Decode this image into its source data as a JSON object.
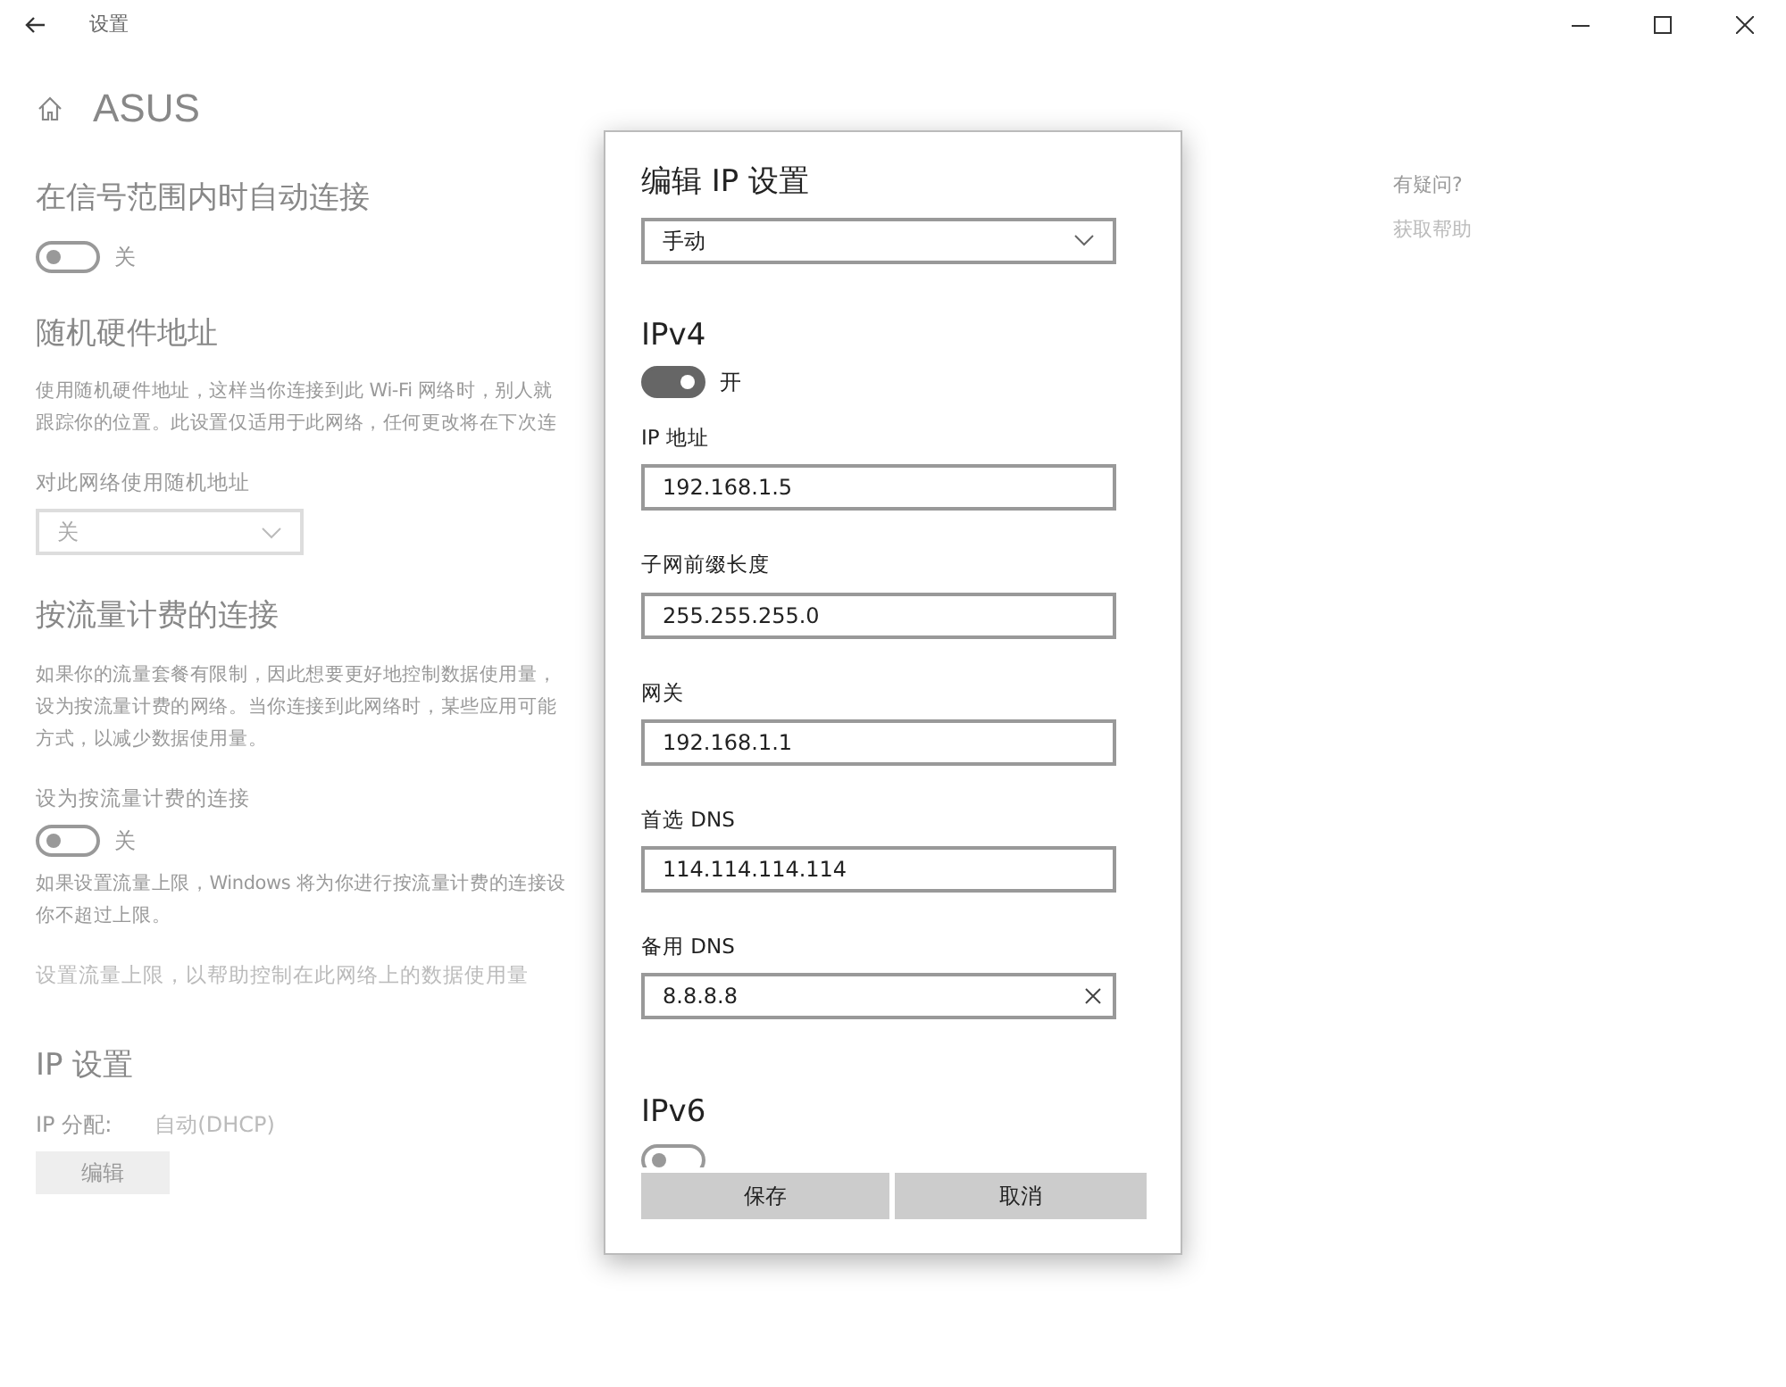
{
  "window": {
    "title": "设置"
  },
  "page": {
    "title": "ASUS",
    "content": [
      {
        "kind": "heading",
        "text": "在信号范围内时自动连接"
      },
      {
        "kind": "toggle",
        "on": false,
        "label": "关"
      },
      {
        "kind": "heading",
        "text": "随机硬件地址"
      },
      {
        "kind": "paragraph",
        "lines": [
          "使用随机硬件地址，这样当你连接到此 Wi-Fi 网络时，别人就",
          "跟踪你的位置。此设置仅适用于此网络，任何更改将在下次连"
        ]
      },
      {
        "kind": "label",
        "text": "对此网络使用随机地址"
      },
      {
        "kind": "dropdown",
        "value": "关"
      },
      {
        "kind": "heading",
        "text": "按流量计费的连接"
      },
      {
        "kind": "paragraph",
        "lines": [
          "如果你的流量套餐有限制，因此想要更好地控制数据使用量，",
          "设为按流量计费的网络。当你连接到此网络时，某些应用可能",
          "方式，以减少数据使用量。"
        ]
      },
      {
        "kind": "label",
        "text": "设为按流量计费的连接"
      },
      {
        "kind": "toggle",
        "on": false,
        "label": "关"
      },
      {
        "kind": "paragraph",
        "lines": [
          "如果设置流量上限，Windows 将为你进行按流量计费的连接设",
          "你不超过上限。"
        ]
      },
      {
        "kind": "link",
        "text": "设置流量上限，以帮助控制在此网络上的数据使用量"
      },
      {
        "kind": "heading",
        "text": "IP 设置"
      },
      {
        "kind": "pair",
        "label": "IP 分配:",
        "value": "自动(DHCP)"
      },
      {
        "kind": "button",
        "text": "编辑"
      }
    ]
  },
  "help": {
    "title": "有疑问?",
    "link": "获取帮助"
  },
  "dialog": {
    "title": "编辑 IP 设置",
    "mode": "手动",
    "ipv4": {
      "heading": "IPv4",
      "on": true,
      "state_label": "开",
      "fields": [
        {
          "label": "IP 地址",
          "value": "192.168.1.5",
          "clearable": false
        },
        {
          "label": "子网前缀长度",
          "value": "255.255.255.0",
          "clearable": false
        },
        {
          "label": "网关",
          "value": "192.168.1.1",
          "clearable": false
        },
        {
          "label": "首选 DNS",
          "value": "114.114.114.114",
          "clearable": false
        },
        {
          "label": "备用 DNS",
          "value": "8.8.8.8",
          "clearable": true
        }
      ]
    },
    "ipv6": {
      "heading": "IPv6",
      "on": false
    },
    "buttons": [
      "保存",
      "取消"
    ]
  }
}
